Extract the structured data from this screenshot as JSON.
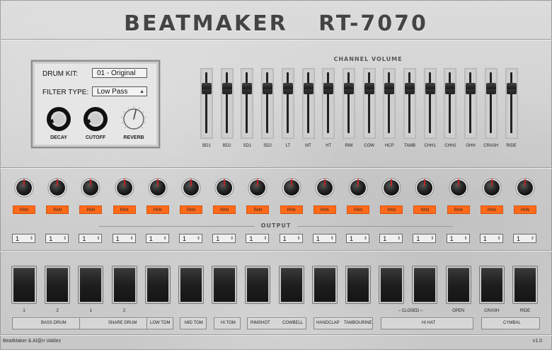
{
  "title": {
    "left": "BEATMAKER",
    "right": "RT-7070"
  },
  "kit": {
    "drum_kit_label": "DRUM KIT:",
    "drum_kit_value": "01 - Original",
    "filter_label": "FILTER TYPE:",
    "filter_value": "Low Pass",
    "knobs": [
      {
        "label": "DECAY",
        "level": 0.1
      },
      {
        "label": "CUTOFF",
        "level": 0.1
      },
      {
        "label": "REVERB",
        "level": 0.55
      }
    ]
  },
  "channel_volume": {
    "label": "CHANNEL VOLUME",
    "channels": [
      {
        "name": "BD1",
        "level": 0.78
      },
      {
        "name": "BD2",
        "level": 0.78
      },
      {
        "name": "SD1",
        "level": 0.78
      },
      {
        "name": "SD2",
        "level": 0.78
      },
      {
        "name": "LT",
        "level": 0.78
      },
      {
        "name": "MT",
        "level": 0.78
      },
      {
        "name": "HT",
        "level": 0.78
      },
      {
        "name": "RIM",
        "level": 0.78
      },
      {
        "name": "COW",
        "level": 0.78
      },
      {
        "name": "HCP",
        "level": 0.78
      },
      {
        "name": "TAMB",
        "level": 0.78
      },
      {
        "name": "CHH1",
        "level": 0.78
      },
      {
        "name": "CHH2",
        "level": 0.78
      },
      {
        "name": "OHH",
        "level": 0.78
      },
      {
        "name": "CRASH",
        "level": 0.78
      },
      {
        "name": "RIDE",
        "level": 0.78
      }
    ]
  },
  "pan": {
    "label": "PAN",
    "count": 16
  },
  "output": {
    "label": "OUTPUT",
    "values": [
      "1",
      "1",
      "1",
      "1",
      "1",
      "1",
      "1",
      "1",
      "1",
      "1",
      "1",
      "1",
      "1",
      "1",
      "1",
      "1"
    ]
  },
  "pad_numbers": [
    "1",
    "2",
    "1",
    "2",
    "",
    "",
    "",
    "",
    "",
    "",
    "",
    "",
    "",
    "OPEN",
    "CRASH",
    "RIDE"
  ],
  "closed_label": "– CLOSED –",
  "groups": {
    "bass_drum": "BASS DRUM",
    "snare_drum": "SNARE DRUM",
    "low_tom": "LOW TOM",
    "mid_tom": "MID TOM",
    "hi_tom": "HI TOM",
    "rimshot": "RIMSHOT",
    "cowbell": "COWBELL",
    "handclap": "HANDCLAP",
    "tambourine": "TAMBOURINE",
    "hi_hat": "HI HAT",
    "cymbal": "CYMBAL"
  },
  "footer": {
    "credit": "BeatMaker & Al@n Valdez",
    "version": "v1.0"
  },
  "colors": {
    "accent": "#ff6a1a",
    "knob_indicator": "#e02020"
  }
}
